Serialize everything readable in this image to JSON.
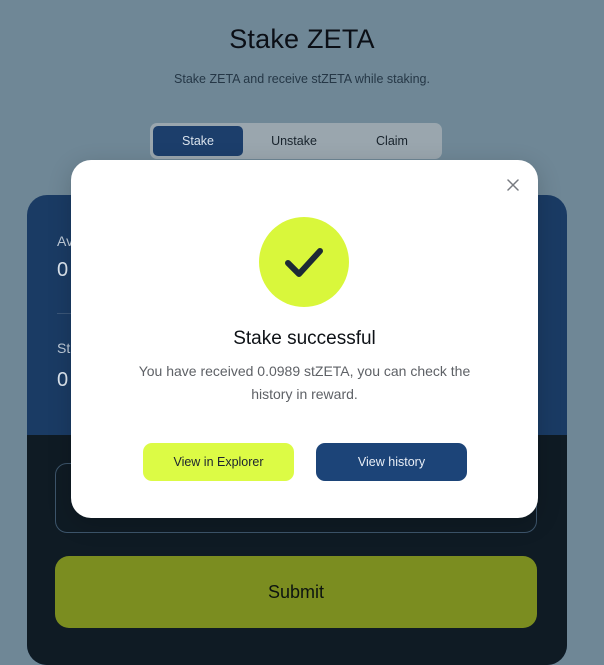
{
  "page": {
    "title": "Stake ZETA",
    "subtitle": "Stake ZETA and receive stZETA while staking."
  },
  "tabs": [
    {
      "label": "Stake",
      "active": true
    },
    {
      "label": "Unstake",
      "active": false
    },
    {
      "label": "Claim",
      "active": false
    }
  ],
  "card": {
    "row1": {
      "label": "Av",
      "value": "0"
    },
    "row2": {
      "label": "St",
      "value": "0"
    },
    "submit_label": "Submit"
  },
  "modal": {
    "title": "Stake successful",
    "message": "You have received 0.0989 stZETA, you can check the history in reward.",
    "explorer_label": "View in Explorer",
    "history_label": "View history",
    "icons": {
      "close": "close-icon",
      "success": "checkmark-icon"
    }
  },
  "colors": {
    "accent": "#dcfb45",
    "primary": "#1c4478",
    "backdrop": "#6f8796"
  }
}
